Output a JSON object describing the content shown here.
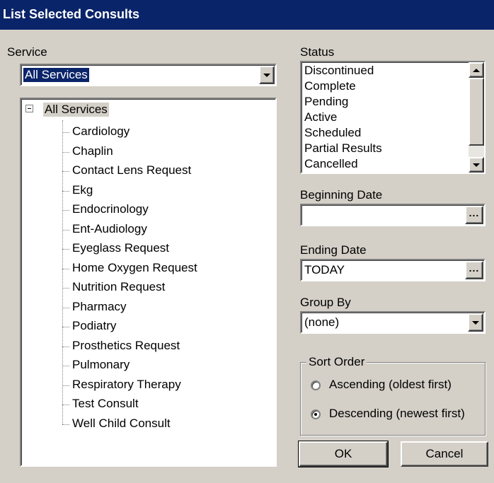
{
  "window": {
    "title": "List Selected Consults"
  },
  "service": {
    "label": "Service",
    "selected": "All Services",
    "tree_root": "All Services",
    "items": [
      "Cardiology",
      "Chaplin",
      "Contact Lens Request",
      "Ekg",
      "Endocrinology",
      "Ent-Audiology",
      "Eyeglass Request",
      "Home Oxygen Request",
      "Nutrition Request",
      "Pharmacy",
      "Podiatry",
      "Prosthetics Request",
      "Pulmonary",
      "Respiratory Therapy",
      "Test Consult",
      "Well Child Consult"
    ]
  },
  "status": {
    "label": "Status",
    "items": [
      "Discontinued",
      "Complete",
      "Pending",
      "Active",
      "Scheduled",
      "Partial Results",
      "Cancelled"
    ]
  },
  "beginning_date": {
    "label": "Beginning Date",
    "value": "",
    "button": "..."
  },
  "ending_date": {
    "label": "Ending Date",
    "value": "TODAY",
    "button": "..."
  },
  "group_by": {
    "label": "Group By",
    "selected": "(none)"
  },
  "sort_order": {
    "label": "Sort Order",
    "ascending": "Ascending (oldest first)",
    "descending": "Descending (newest first)",
    "selected": "descending"
  },
  "buttons": {
    "ok": "OK",
    "cancel": "Cancel"
  }
}
